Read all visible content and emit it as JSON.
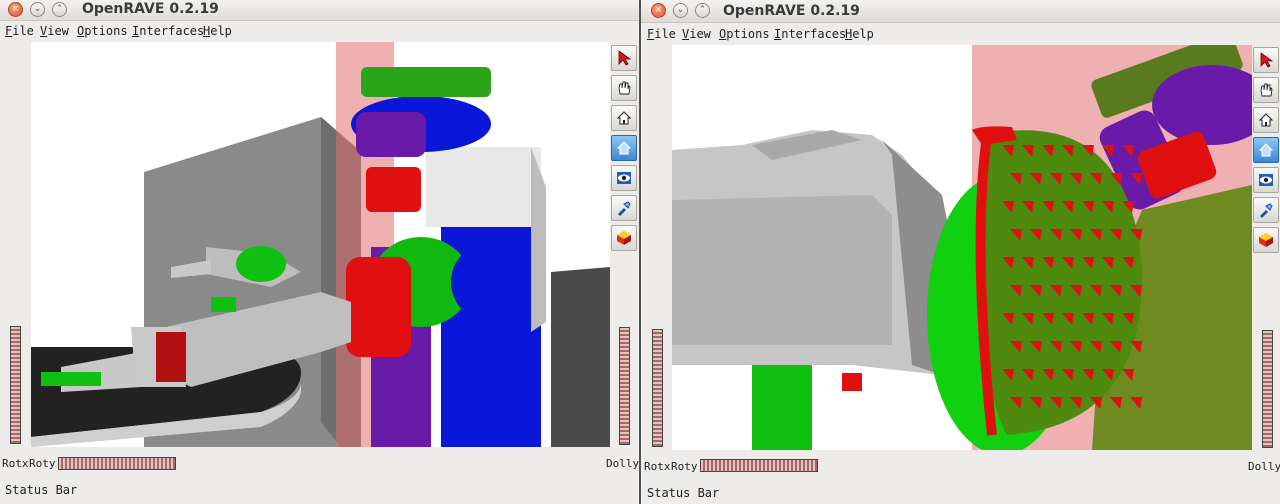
{
  "windows": [
    {
      "title": "OpenRAVE 0.2.19",
      "menu": [
        "File",
        "View",
        "Options",
        "Interfaces",
        "Help"
      ],
      "rotx_label": "Rotx",
      "roty_label": "Roty",
      "dolly_label": "Dolly",
      "status": "Status Bar"
    },
    {
      "title": "OpenRAVE 0.2.19",
      "menu": [
        "File",
        "View",
        "Options",
        "Interfaces",
        "Help"
      ],
      "rotx_label": "Rotx",
      "roty_label": "Roty",
      "dolly_label": "Dolly",
      "status": "Status Bar"
    }
  ],
  "toolbar_icons": [
    "select-arrow-icon",
    "pan-hand-icon",
    "home-icon",
    "set-home-icon",
    "view-all-eye-icon",
    "seek-flashlight-icon",
    "projection-cube-icon"
  ],
  "colors": {
    "robot_red": "#e01010",
    "robot_green": "#10d010",
    "robot_blue": "#0a16d8",
    "robot_purple": "#6a1aa8",
    "background": "#ffffff"
  }
}
